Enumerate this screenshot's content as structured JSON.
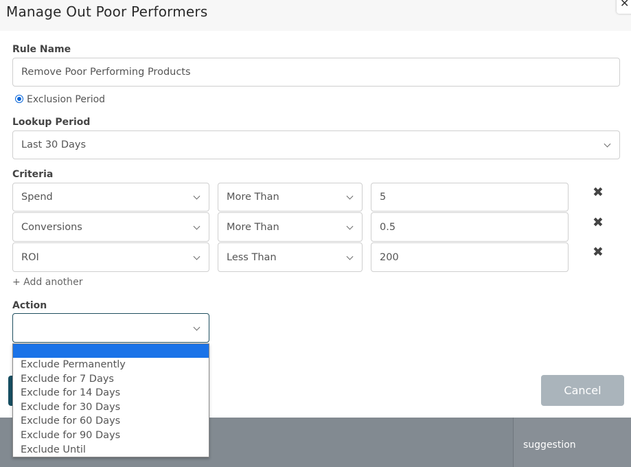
{
  "modal": {
    "title": "Manage Out Poor Performers",
    "close_icon": "✕"
  },
  "rule_name": {
    "label": "Rule Name",
    "value": "Remove Poor Performing Products"
  },
  "exclusion_period": {
    "label": "Exclusion Period",
    "checked": true
  },
  "lookup_period": {
    "label": "Lookup Period",
    "value": "Last 30 Days"
  },
  "criteria": {
    "label": "Criteria",
    "rows": [
      {
        "metric": "Spend",
        "operator": "More Than",
        "value": "5",
        "remove_icon": "✖"
      },
      {
        "metric": "Conversions",
        "operator": "More Than",
        "value": "0.5",
        "remove_icon": "✖"
      },
      {
        "metric": "ROI",
        "operator": "Less Than",
        "value": "200",
        "remove_icon": "✖"
      }
    ],
    "add_another": "+ Add another"
  },
  "action": {
    "label": "Action",
    "value": "",
    "options": [
      "",
      "Exclude Permanently",
      "Exclude for 7 Days",
      "Exclude for 14 Days",
      "Exclude for 30 Days",
      "Exclude for 60 Days",
      "Exclude for 90 Days",
      "Exclude Until"
    ]
  },
  "buttons": {
    "cancel": "Cancel"
  },
  "background": {
    "table_cell": "suggestion"
  },
  "colors": {
    "accent": "#174f62",
    "selection": "#1a73e8",
    "cancel_bg": "#aab4bb",
    "overlay": "#828a91"
  }
}
